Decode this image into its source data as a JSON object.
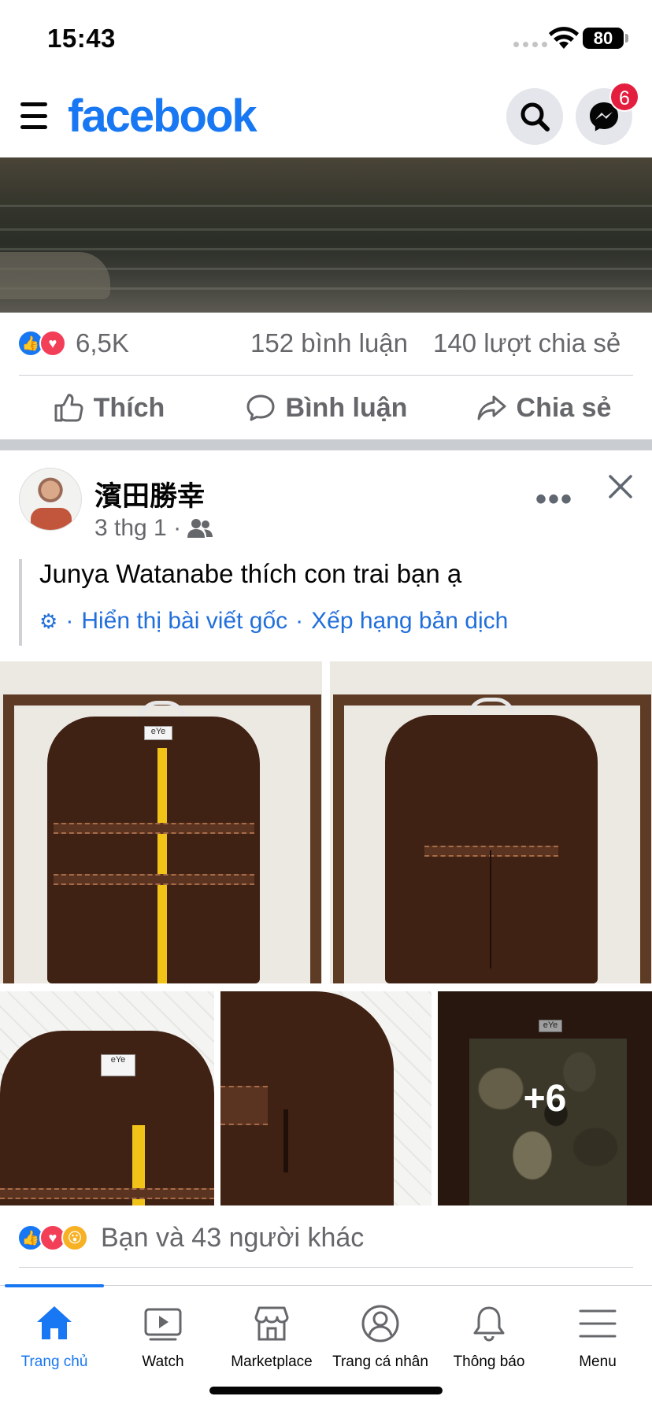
{
  "status_bar": {
    "time": "15:43",
    "battery": "80"
  },
  "header": {
    "logo": "facebook",
    "messenger_badge": "6"
  },
  "feed_item": {
    "reaction_count": "6,5K",
    "comment_count": "152 bình luận",
    "share_count": "140 lượt chia sẻ",
    "actions": {
      "like": "Thích",
      "comment": "Bình luận",
      "share": "Chia sẻ"
    }
  },
  "post": {
    "author": "濱田勝幸",
    "date": "3 thg 1 ·",
    "audience_icon": "friends-icon",
    "text": "Junya Watanabe thích con trai bạn ạ",
    "translation": {
      "show_original": "Hiển thị bài viết gốc",
      "separator": "·",
      "rate_translation": "Xếp hạng bản dịch"
    },
    "more_photos_count": "+6",
    "reactions_text": "Bạn và 43 người khác"
  },
  "bottom_nav": {
    "items": [
      {
        "label": "Trang chủ",
        "icon": "home-icon",
        "active": true
      },
      {
        "label": "Watch",
        "icon": "watch-icon",
        "active": false
      },
      {
        "label": "Marketplace",
        "icon": "marketplace-icon",
        "active": false
      },
      {
        "label": "Trang cá nhân",
        "icon": "profile-icon",
        "active": false
      },
      {
        "label": "Thông báo",
        "icon": "bell-icon",
        "active": false
      },
      {
        "label": "Menu",
        "icon": "menu-icon",
        "active": false
      }
    ]
  },
  "colors": {
    "brand": "#1877f2",
    "badge": "#e41e3f",
    "secondary_text": "#65676b",
    "link": "#216fdb"
  }
}
